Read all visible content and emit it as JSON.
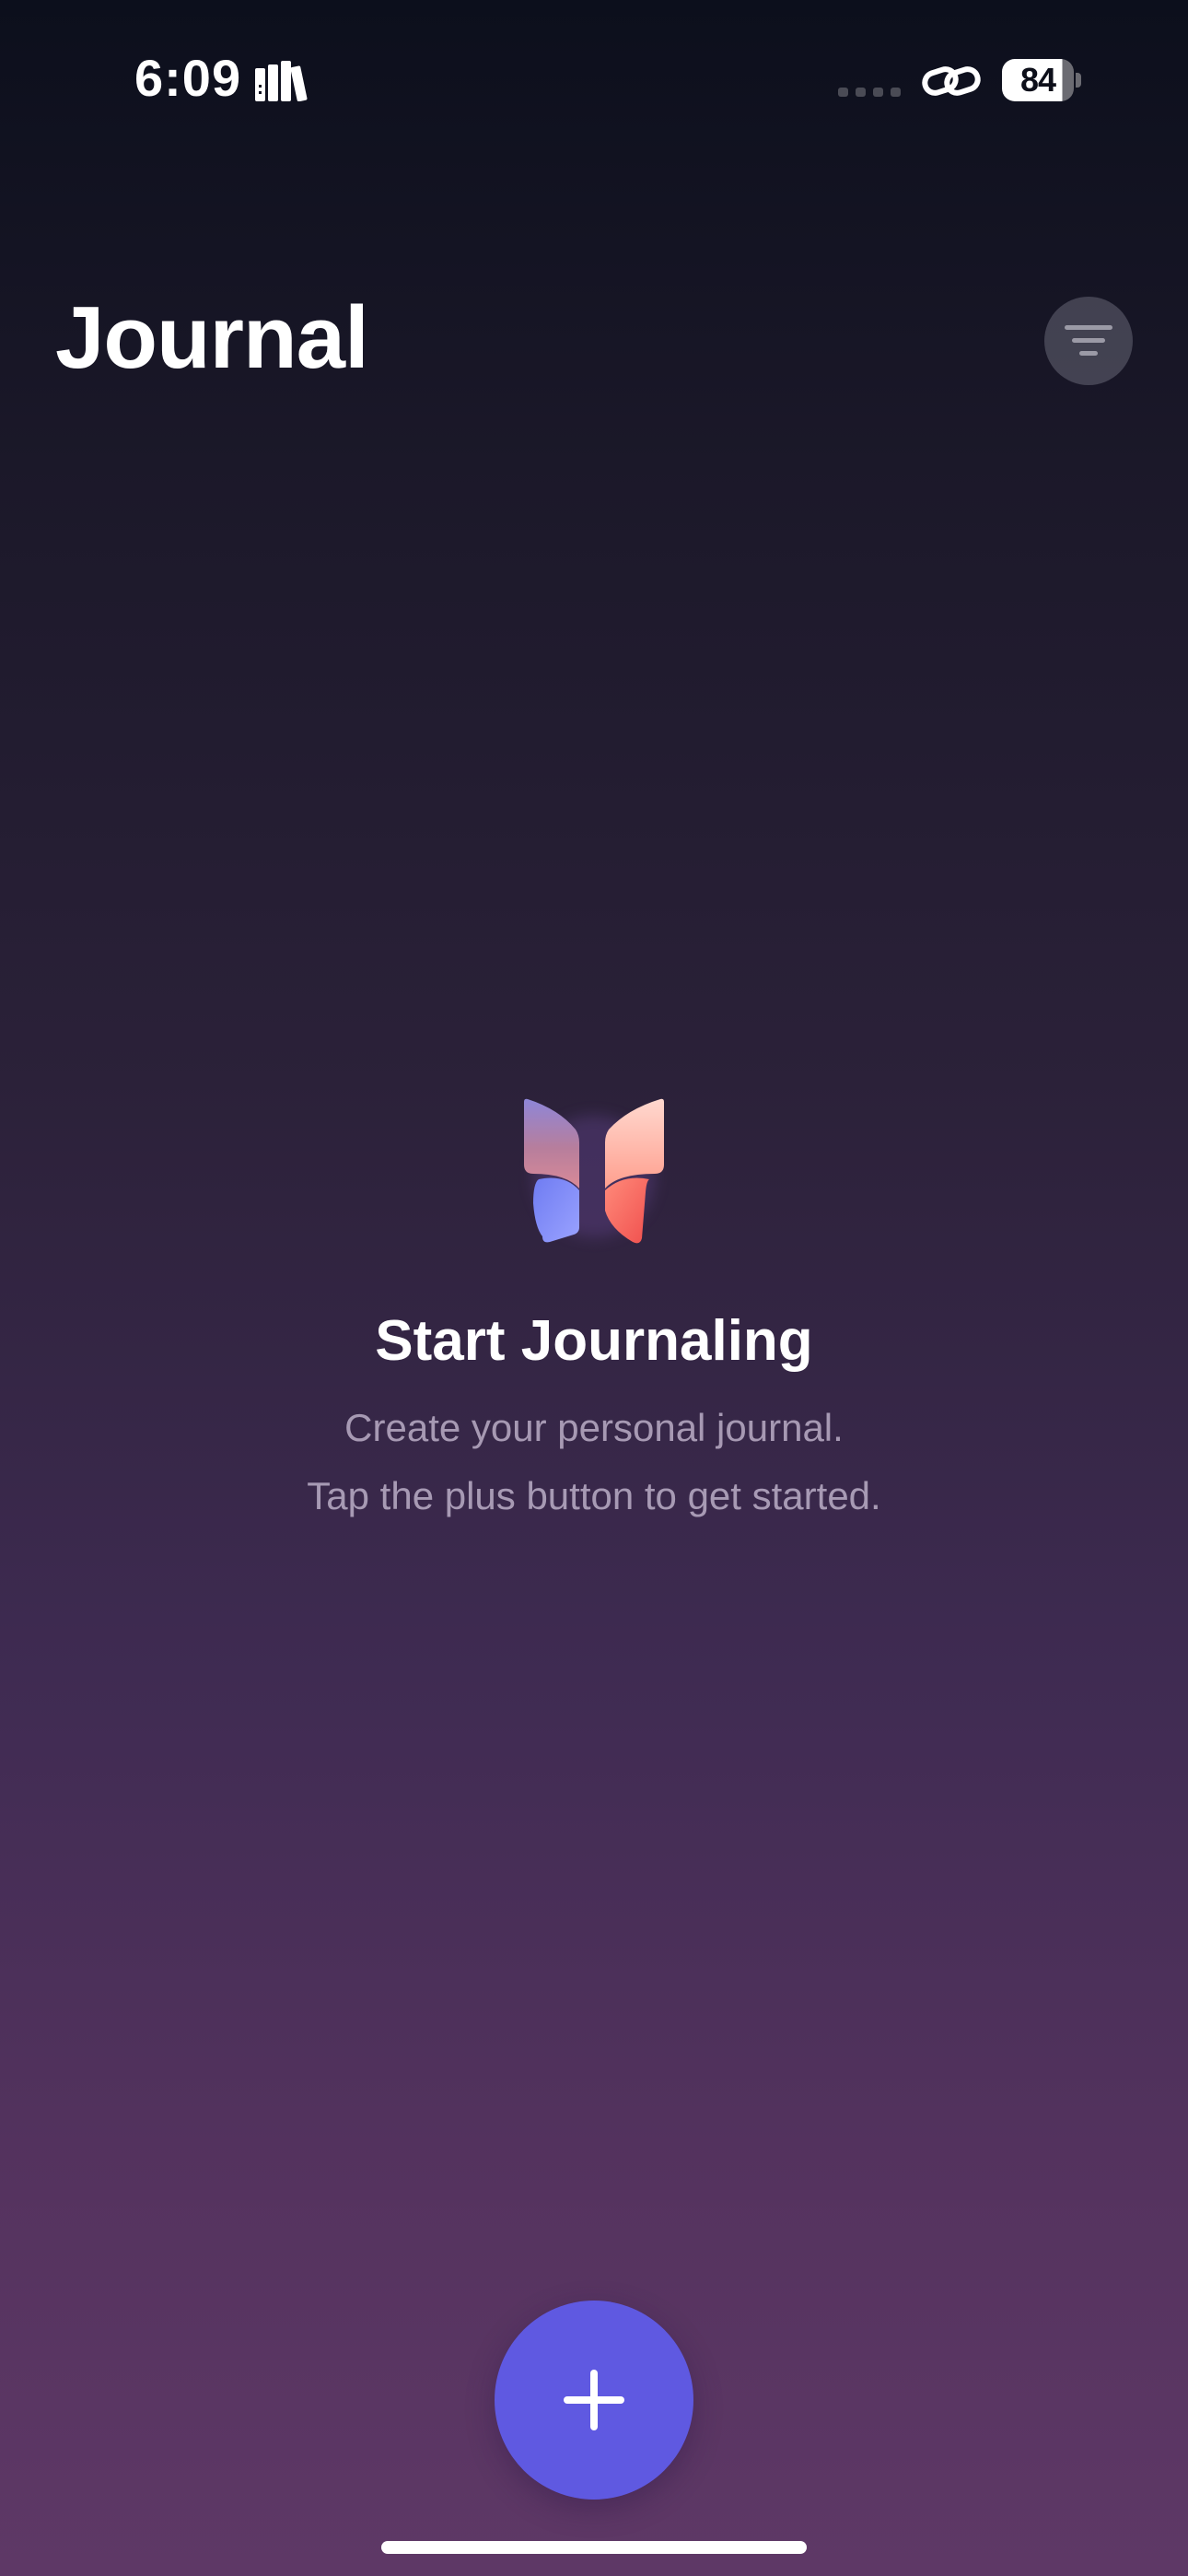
{
  "status_bar": {
    "time": "6:09",
    "battery_level": "84"
  },
  "header": {
    "title": "Journal"
  },
  "empty_state": {
    "title": "Start Journaling",
    "line_1": "Create your personal journal.",
    "line_2": "Tap the plus button to get started."
  },
  "icons": {
    "status_app": "library-books-icon",
    "signal": "cellular-dots-icon",
    "connection": "link-icon",
    "filter": "filter-lines-icon",
    "logo": "journal-app-logo",
    "add": "plus-icon"
  },
  "colors": {
    "accent": "#5F59E1",
    "background_top": "#0C0F1C",
    "background_bottom": "#5E3866"
  }
}
